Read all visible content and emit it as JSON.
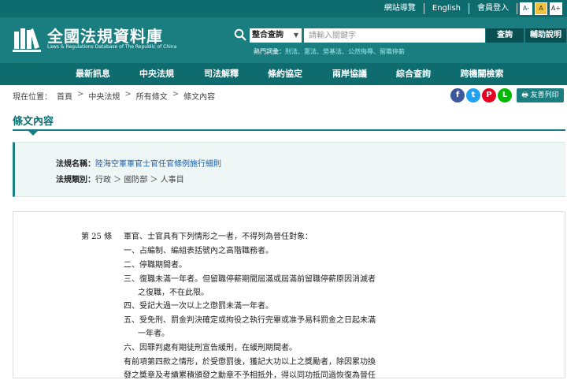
{
  "topbar": {
    "links": [
      "網站導覽",
      "English",
      "會員登入"
    ],
    "font_buttons": [
      "A-",
      "A",
      "A+"
    ]
  },
  "header": {
    "title": "全國法規資料庫",
    "subtitle": "Laws & Regulations Database of The Republic of China",
    "search_type": "整合查詢",
    "search_placeholder": "請輸入關鍵字",
    "query_button": "查詢",
    "help_button": "輔助說明",
    "hot_label": "熱門詞彙：",
    "hot_terms": "刑法、憲法、勞基法、公然侮辱、留職停薪"
  },
  "nav": [
    "最新訊息",
    "中央法規",
    "司法解釋",
    "條約協定",
    "兩岸協議",
    "綜合查詢",
    "跨機關檢索"
  ],
  "breadcrumb": {
    "prefix": "現在位置：",
    "items": [
      "首頁",
      "中央法規",
      "所有條文",
      "條文內容"
    ]
  },
  "social": {
    "f": "f",
    "t": "t",
    "p": "P",
    "line": "L"
  },
  "print_button": "友善列印",
  "section_title": "條文內容",
  "law": {
    "name_label": "法規名稱：",
    "name": "陸海空軍軍官士官任官條例施行細則",
    "category_label": "法規類別：",
    "category": "行政 ＞ 國防部 ＞ 人事目"
  },
  "article": {
    "number": "第 25 條",
    "lines": [
      "軍官、士官具有下列情形之一者，不得列為晉任對象：",
      "一、占編制、編組表括號內之高階職務者。",
      "二、停職期間者。",
      "三、復職未滿一年者。但留職停薪期間屆滿或屆滿前留職停薪原因消滅者",
      "之復職，不在此限。",
      "四、受記大過一次以上之懲罰未滿一年者。",
      "五、受免刑、罰金判決確定或拘役之執行完畢或准予易科罰金之日起未滿",
      "一年者。",
      "六、因罪判處有期徒刑宣告緩刑，在緩刑期間者。",
      "有前項第四款之情形，於受懲罰後，獲記大功以上之獎勵者，除因累功換",
      "發之獎章及考績累積頒發之勳章不予相抵外，得以同功抵同過恢復為晉任"
    ]
  }
}
